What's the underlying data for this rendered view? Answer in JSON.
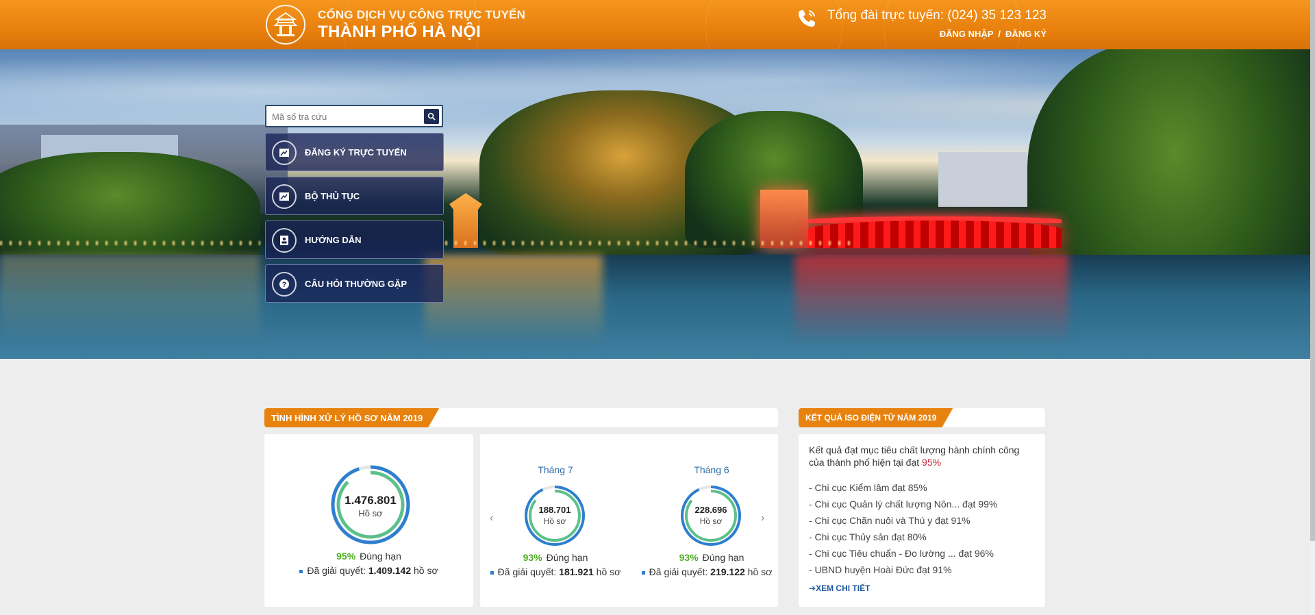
{
  "header": {
    "brand_line1": "CỔNG DỊCH VỤ CÔNG TRỰC TUYẾN",
    "brand_line2": "THÀNH PHỐ HÀ NỘI",
    "hotline": "Tổng đài trực tuyến: (024) 35 123 123",
    "login_label": "ĐĂNG NHẬP",
    "separator": "/",
    "register_label": "ĐĂNG KÝ"
  },
  "search": {
    "placeholder": "Mã số tra cứu"
  },
  "menu": [
    {
      "label": "ĐĂNG KÝ TRỰC TUYẾN",
      "icon": "image-edit-icon"
    },
    {
      "label": "BỘ THỦ TỤC",
      "icon": "image-icon"
    },
    {
      "label": "HƯỚNG DẪN",
      "icon": "contact-card-icon"
    },
    {
      "label": "CÂU HỎI THƯỜNG GẶP",
      "icon": "question-icon"
    }
  ],
  "processing": {
    "title": "TÌNH HÌNH XỬ LÝ HỒ SƠ NĂM 2019",
    "total": {
      "value": "1.476.801",
      "unit": "Hồ sơ",
      "percent": "95%",
      "percent_label": "Đúng hạn",
      "resolved_label": "Đã giải quyết:",
      "resolved_value": "1.409.142",
      "resolved_unit": "hồ sơ"
    },
    "months": [
      {
        "month": "Tháng 7",
        "value": "188.701",
        "unit": "Hồ sơ",
        "percent": "93%",
        "percent_label": "Đúng hạn",
        "resolved_label": "Đã giải quyết:",
        "resolved_value": "181.921",
        "resolved_unit": "hồ sơ"
      },
      {
        "month": "Tháng 6",
        "value": "228.696",
        "unit": "Hồ sơ",
        "percent": "93%",
        "percent_label": "Đúng hạn",
        "resolved_label": "Đã giải quyết:",
        "resolved_value": "219.122",
        "resolved_unit": "hồ sơ"
      }
    ],
    "prev_arrow": "‹",
    "next_arrow": "›"
  },
  "iso": {
    "title": "KẾT QUẢ ISO ĐIỆN TỬ NĂM 2019",
    "intro": "Kết quả đạt mục tiêu chất lượng hành chính công của thành phố hiện tại đạt",
    "intro_pct": "95%",
    "items": [
      "- Chi cục Kiểm lâm đạt 85%",
      "- Chi cục Quản lý chất lượng Nôn... đạt 99%",
      "- Chi cục Chăn nuôi và Thú y đạt 91%",
      "- Chi cục Thủy sản đạt 80%",
      "- Chi cục Tiêu chuẩn - Đo lường ... đạt 96%",
      "- UBND huyện Hoài Đức đạt 91%"
    ],
    "more_label": "XEM CHI TIẾT"
  },
  "colors": {
    "header_orange": "#e8820f",
    "menu_bg": "#182256",
    "percent_green": "#4cae22",
    "donut_blue": "#2e7fcf",
    "donut_green": "#4cae22",
    "highlight_red": "#c6283e"
  }
}
